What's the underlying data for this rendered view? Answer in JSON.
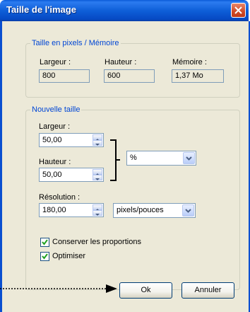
{
  "window": {
    "title": "Taille de l'image"
  },
  "pixel_group": {
    "legend": "Taille en pixels / Mémoire",
    "width_label": "Largeur :",
    "width_value": "800",
    "height_label": "Hauteur :",
    "height_value": "600",
    "memory_label": "Mémoire :",
    "memory_value": "1,37 Mo"
  },
  "new_size_group": {
    "legend": "Nouvelle taille",
    "width_label": "Largeur :",
    "width_value": "50,00",
    "height_label": "Hauteur :",
    "height_value": "50,00",
    "unit_value": "%",
    "resolution_label": "Résolution :",
    "resolution_value": "180,00",
    "resolution_unit": "pixels/pouces",
    "keep_proportions_label": "Conserver les proportions",
    "keep_proportions_checked": true,
    "optimize_label": "Optimiser",
    "optimize_checked": true
  },
  "buttons": {
    "ok": "Ok",
    "cancel": "Annuler"
  },
  "icons": {
    "close": "close-icon",
    "spin": "spin-up-down-icon",
    "dropdown": "chevron-down-icon",
    "check": "checkmark-icon",
    "bracket": "link-bracket-icon",
    "arrow": "dotted-arrow-icon"
  },
  "colors": {
    "titlebar": "#0a5bd8",
    "dialog_bg": "#ece9d8",
    "group_legend": "#0046d5",
    "close_button": "#cf4a27",
    "checkmark": "#21a121"
  }
}
